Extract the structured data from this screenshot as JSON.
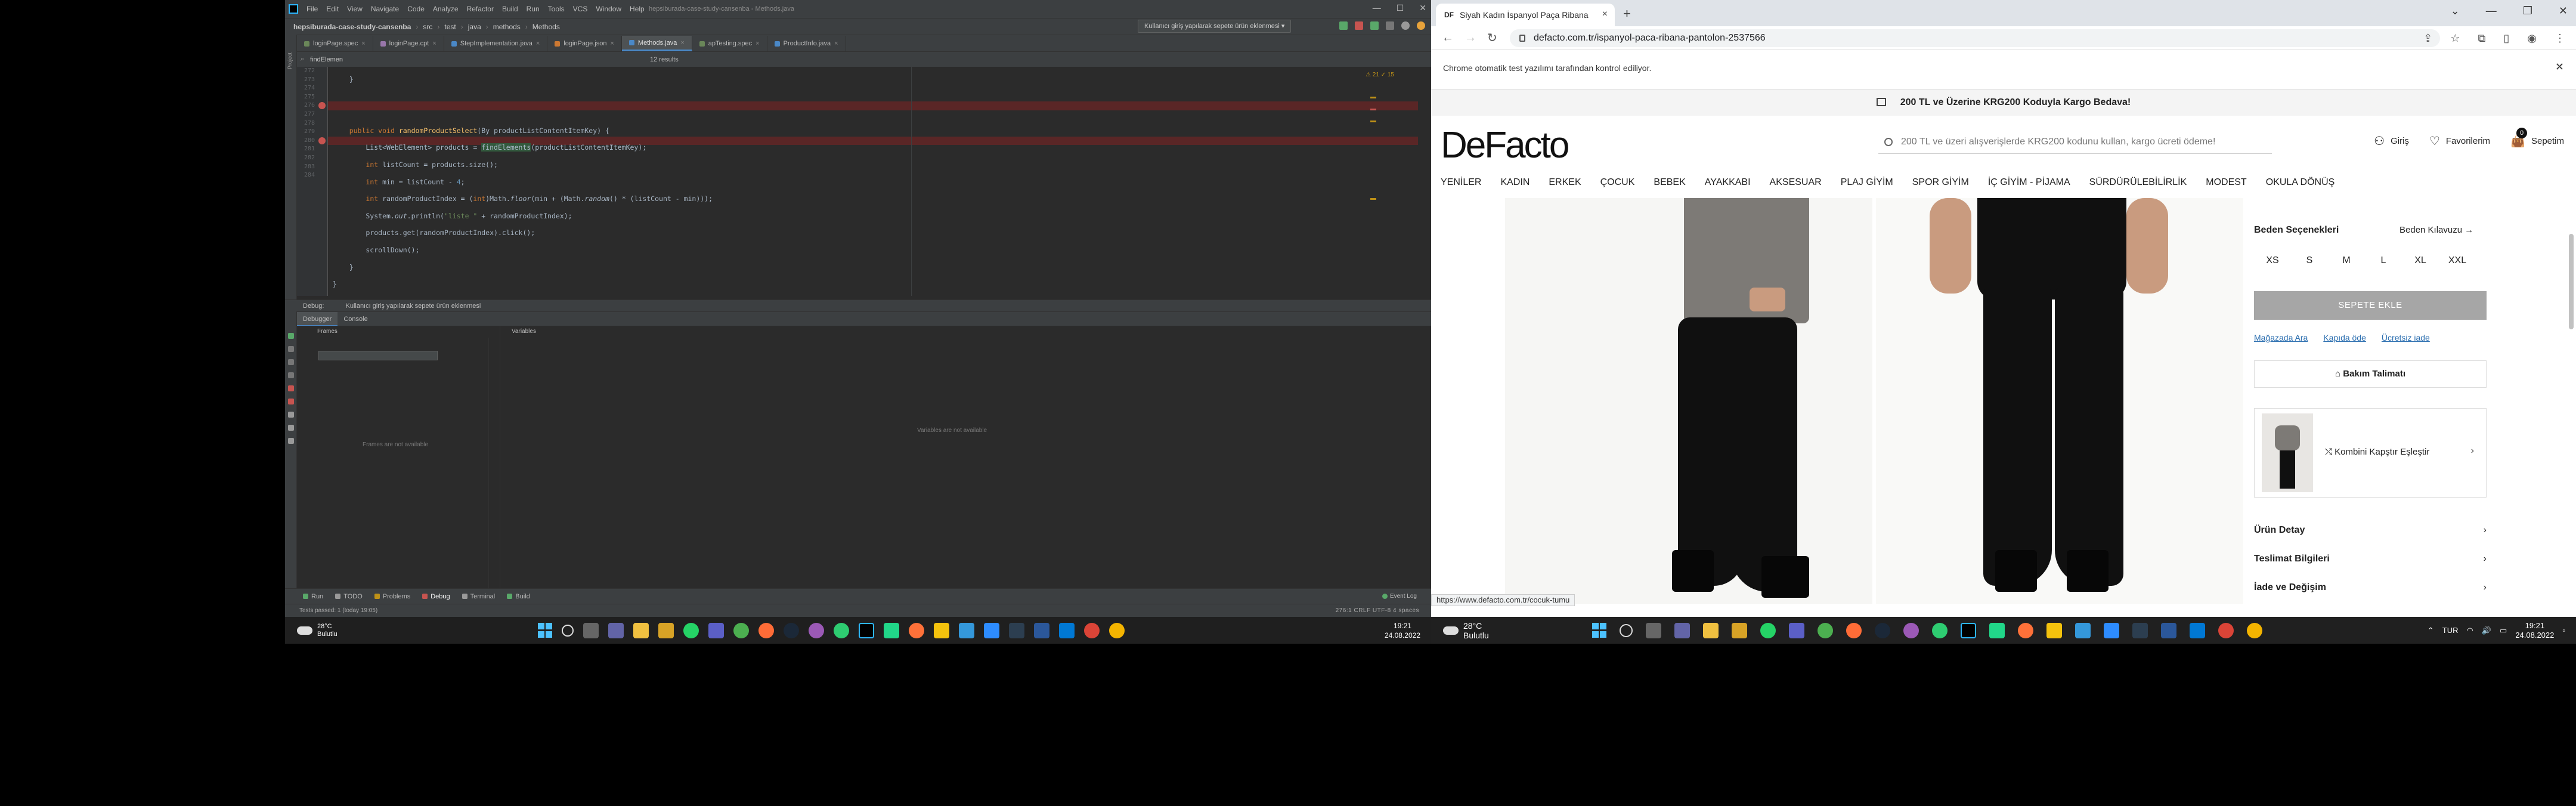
{
  "ide": {
    "menu": [
      "File",
      "Edit",
      "View",
      "Navigate",
      "Code",
      "Analyze",
      "Refactor",
      "Build",
      "Run",
      "Tools",
      "VCS",
      "Window",
      "Help"
    ],
    "title": "hepsiburada-case-study-cansenba - Methods.java",
    "breadcrumbs": [
      "hepsiburada-case-study-cansenba",
      "src",
      "test",
      "java",
      "methods",
      "Methods"
    ],
    "run_config": "Kullanıcı giriş yapılarak sepete ürün eklenmesi",
    "tabs": [
      {
        "label": "loginPage.spec",
        "color": "#6a8759",
        "active": false
      },
      {
        "label": "loginPage.cpt",
        "color": "#9876aa",
        "active": false
      },
      {
        "label": "StepImplementation.java",
        "color": "#4a88c7",
        "active": false
      },
      {
        "label": "loginPage.json",
        "color": "#cc7832",
        "active": false
      },
      {
        "label": "Methods.java",
        "color": "#4a88c7",
        "active": true
      },
      {
        "label": "apTesting.spec",
        "color": "#6a8759",
        "active": false
      },
      {
        "label": "ProductInfo.java",
        "color": "#4a88c7",
        "active": false
      }
    ],
    "find_query": "findElemen",
    "find_results": "12 results",
    "inspection": "⚠ 21  ✓ 15",
    "line_numbers": [
      "272",
      "273",
      "274",
      "275",
      "276",
      "277",
      "278",
      "279",
      "280",
      "281",
      "282",
      "283",
      "284"
    ],
    "breakpoint_lines": [
      4,
      8
    ],
    "debug_label": "Debug:",
    "debug_session": "Kullanıcı giriş yapılarak sepete ürün eklenmesi",
    "debug_tabs": [
      "Debugger",
      "Console"
    ],
    "frames_label": "Frames",
    "frames_empty": "Frames are not available",
    "variables_label": "Variables",
    "variables_empty": "Variables are not available",
    "bottom_tabs": [
      {
        "label": "Run",
        "color": "#59a869",
        "active": false
      },
      {
        "label": "TODO",
        "color": "#999",
        "active": false
      },
      {
        "label": "Problems",
        "color": "#be9117",
        "active": false
      },
      {
        "label": "Debug",
        "color": "#c75450",
        "active": true
      },
      {
        "label": "Terminal",
        "color": "#999",
        "active": false
      },
      {
        "label": "Build",
        "color": "#59a869",
        "active": false
      }
    ],
    "event_log": "Event Log",
    "status_msg": "Tests passed: 1 (today 19:05)",
    "status_pos": "276:1   CRLF   UTF-8   4 spaces"
  },
  "taskbar_left": {
    "temp": "28°C",
    "cond": "Bulutlu",
    "time": "19:21",
    "date": "24.08.2022"
  },
  "browser": {
    "tab_title": "Siyah Kadın İspanyol Paça Ribana",
    "tab_favicon": "DF",
    "url": "defacto.com.tr/ispanyol-paca-ribana-pantolon-2537566",
    "infobar": "Chrome otomatik test yazılımı tarafından kontrol ediliyor.",
    "hover_url": "https://www.defacto.com.tr/cocuk-tumu"
  },
  "site": {
    "promo": "200 TL ve Üzerine KRG200 Koduyla Kargo Bedava!",
    "logo": "DeFacto",
    "search_placeholder": "200 TL ve üzeri alışverişlerde KRG200 kodunu kullan, kargo ücreti ödeme!",
    "login": "Giriş",
    "favorites": "Favorilerim",
    "cart": "Sepetim",
    "cart_count": "0",
    "categories": [
      "YENİLER",
      "KADIN",
      "ERKEK",
      "ÇOCUK",
      "BEBEK",
      "AYAKKABI",
      "AKSESUAR",
      "PLAJ GİYİM",
      "SPOR GİYİM",
      "İÇ GİYİM - PİJAMA",
      "SÜRDÜRÜLEBİLİRLİK",
      "MODEST",
      "OKULA DÖNÜŞ"
    ],
    "size_options_title": "Beden Seçenekleri",
    "size_guide": "Beden Kılavuzu →",
    "sizes": [
      "XS",
      "S",
      "M",
      "L",
      "XL",
      "XXL"
    ],
    "add_to_cart": "SEPETE EKLE",
    "store_link": "Mağazada Ara",
    "pay_door": "Kapıda öde",
    "free_return": "Ücretsiz iade",
    "care": "Bakım Talimatı",
    "combine": "Kombini Kapştır Eşleştir",
    "accordions": [
      "Ürün Detay",
      "Teslimat Bilgileri",
      "İade ve Değişim"
    ]
  },
  "taskbar_right": {
    "temp": "28°C",
    "cond": "Bulutlu",
    "lang": "TUR",
    "time": "19:21",
    "date": "24.08.2022"
  }
}
